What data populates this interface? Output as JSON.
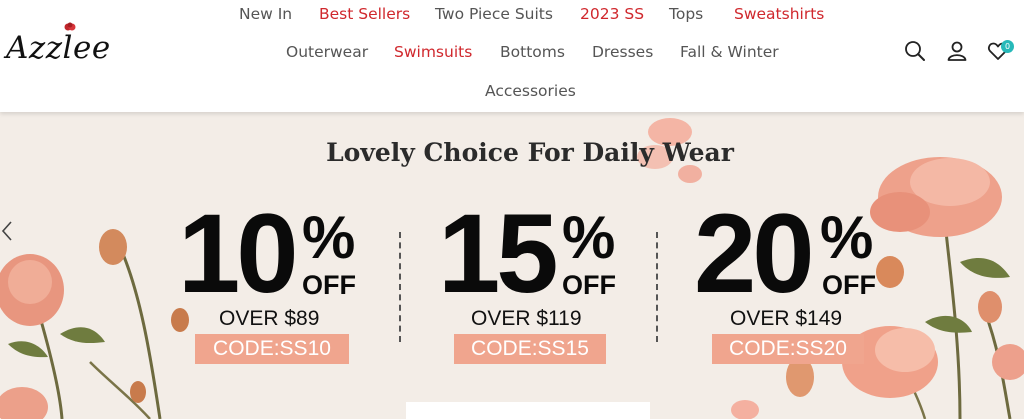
{
  "header": {
    "logo": "Azzlee",
    "nav_row1": [
      "New In",
      "Best Sellers",
      "Two Piece Suits",
      "2023 SS",
      "Tops",
      "Sweatshirts"
    ],
    "nav_row2": [
      "Outerwear",
      "Swimsuits",
      "Bottoms",
      "Dresses",
      "Fall & Winter"
    ],
    "nav_row3": [
      "Accessories"
    ],
    "cart_count": "0",
    "icons": [
      "search-icon",
      "user-icon",
      "heart-icon"
    ],
    "highlight_color": "#d0282d"
  },
  "banner": {
    "title": "Lovely Choice For Daily Wear",
    "offers": [
      {
        "percent": "10",
        "sign": "%",
        "off": "OFF",
        "over": "OVER $89",
        "code": "CODE:SS10"
      },
      {
        "percent": "15",
        "sign": "%",
        "off": "OFF",
        "over": "OVER $119",
        "code": "CODE:SS15"
      },
      {
        "percent": "20",
        "sign": "%",
        "off": "OFF",
        "over": "OVER $149",
        "code": "CODE:SS20"
      }
    ],
    "code_color": "#f0a58e"
  }
}
